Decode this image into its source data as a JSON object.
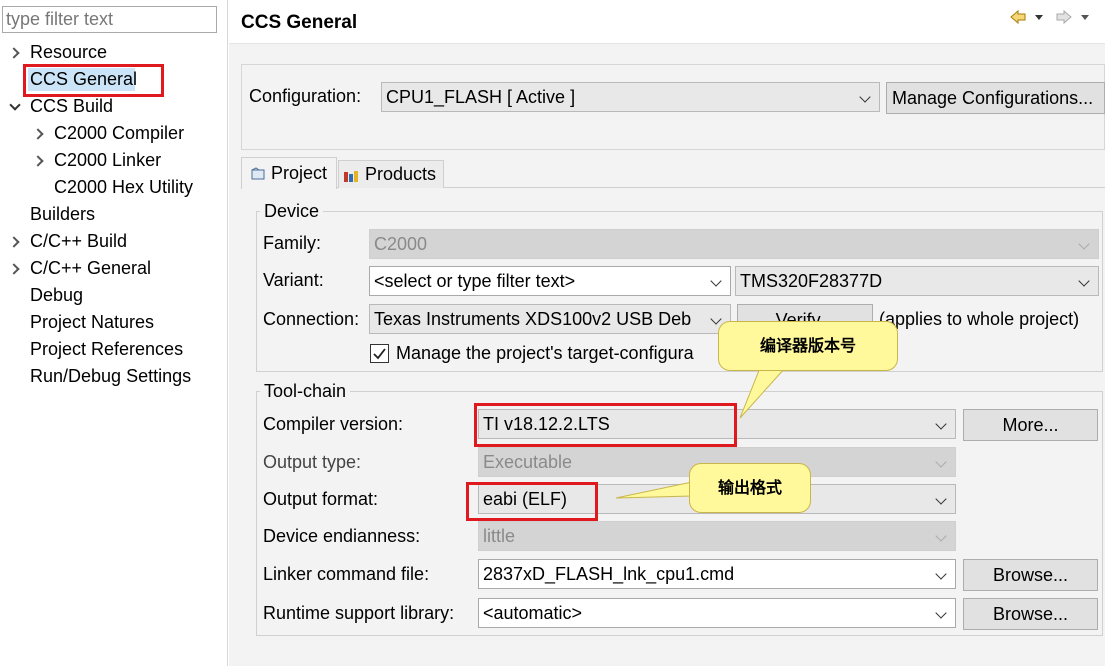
{
  "filter": {
    "placeholder": "type filter text"
  },
  "tree": [
    {
      "label": "Resource",
      "expander": "right",
      "indent": 0
    },
    {
      "label": "CCS General",
      "expander": "none",
      "indent": 0,
      "selected": true
    },
    {
      "label": "CCS Build",
      "expander": "down",
      "indent": 0
    },
    {
      "label": "C2000 Compiler",
      "expander": "right",
      "indent": 1
    },
    {
      "label": "C2000 Linker",
      "expander": "right",
      "indent": 1
    },
    {
      "label": "C2000 Hex Utility",
      "expander": "none",
      "indent": 1
    },
    {
      "label": "Builders",
      "expander": "none",
      "indent": 0
    },
    {
      "label": "C/C++ Build",
      "expander": "right",
      "indent": 0
    },
    {
      "label": "C/C++ General",
      "expander": "right",
      "indent": 0
    },
    {
      "label": "Debug",
      "expander": "none",
      "indent": 0
    },
    {
      "label": "Project Natures",
      "expander": "none",
      "indent": 0
    },
    {
      "label": "Project References",
      "expander": "none",
      "indent": 0
    },
    {
      "label": "Run/Debug Settings",
      "expander": "none",
      "indent": 0
    }
  ],
  "page": {
    "title": "CCS General"
  },
  "configuration": {
    "label": "Configuration:",
    "value": "CPU1_FLASH  [ Active ]",
    "manage_button": "Manage Configurations..."
  },
  "tabs": [
    {
      "label": "Project",
      "icon": "project-icon",
      "active": true
    },
    {
      "label": "Products",
      "icon": "products-icon",
      "active": false
    }
  ],
  "device": {
    "group_label": "Device",
    "family_label": "Family:",
    "family_value": "C2000",
    "variant_label": "Variant:",
    "variant_filter": "<select or type filter text>",
    "variant_value": "TMS320F28377D",
    "connection_label": "Connection:",
    "connection_value": "Texas Instruments XDS100v2 USB Deb",
    "verify_button": "Verify...",
    "verify_note": "(applies to whole project)",
    "manage_target_label": "Manage the project's target-configura",
    "manage_target_checked": true
  },
  "toolchain": {
    "group_label": "Tool-chain",
    "compiler_label": "Compiler version:",
    "compiler_value": "TI v18.12.2.LTS",
    "more_button": "More...",
    "output_type_label": "Output type:",
    "output_type_value": "Executable",
    "output_format_label": "Output format:",
    "output_format_value": "eabi (ELF)",
    "endianness_label": "Device endianness:",
    "endianness_value": "little",
    "linker_label": "Linker command file:",
    "linker_value": "2837xD_FLASH_lnk_cpu1.cmd",
    "linker_browse": "Browse...",
    "runtime_label": "Runtime support library:",
    "runtime_value": "<automatic>",
    "runtime_browse": "Browse..."
  },
  "annotations": {
    "compiler_callout": "编译器版本号",
    "format_callout": "输出格式"
  },
  "colors": {
    "highlight": "#e0191f",
    "callout": "#fff99c",
    "selection": "#cce4f7"
  }
}
